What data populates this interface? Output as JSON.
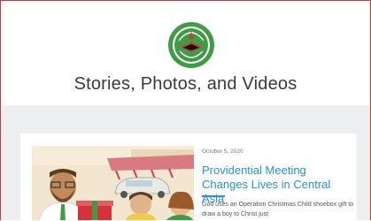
{
  "header": {
    "logo_icon": "operation-christmas-child-logo",
    "title": "Stories, Photos, and Videos"
  },
  "article": {
    "date": "October 5, 2020",
    "headline": "Providential Meeting Changes Lives in Central Asia",
    "excerpt": "God uses an Operation Christmas Child shoebox gift to draw a boy to Christ just"
  },
  "colors": {
    "frame": "#d6323b",
    "accent": "#2b8fd6",
    "logo_green": "#3f9b46",
    "background": "#eceef0"
  }
}
